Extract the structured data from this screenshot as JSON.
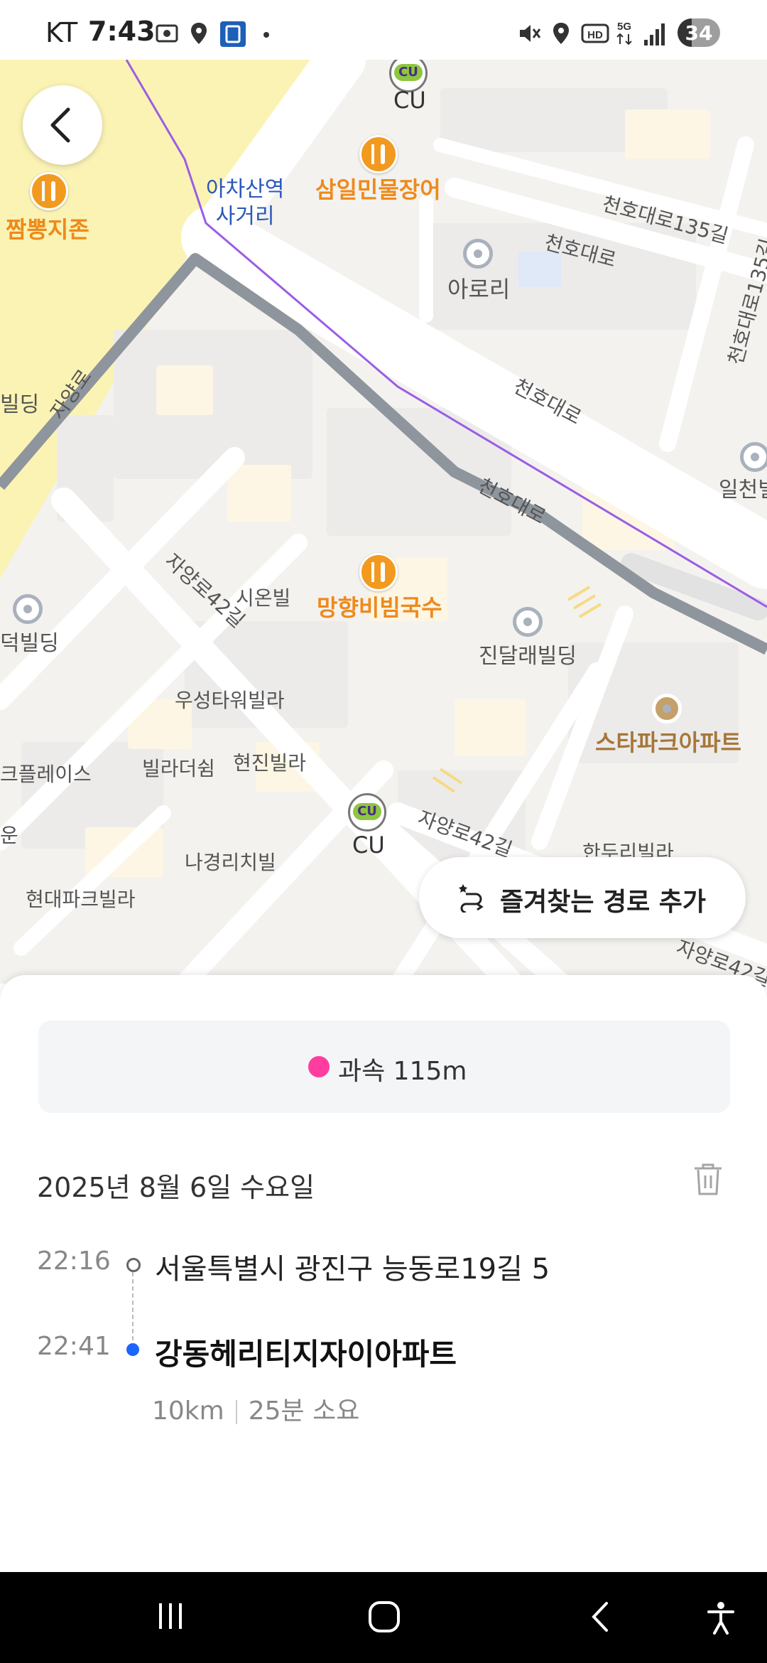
{
  "status_bar": {
    "carrier": "KT",
    "time": "7:43",
    "battery": "34",
    "battery_level": 0.34
  },
  "map": {
    "labels": {
      "intersection": "아차산역\n사거리",
      "poi_jjambbong": "짬뽕지존",
      "poi_samil": "삼일민물장어",
      "poi_manghyang": "망향비빔국수",
      "cu_top": "CU",
      "cu_bottom": "CU",
      "arori": "아로리",
      "cheonho135": "천호대로135길",
      "cheonho_small": "천호대로",
      "cheonho_mid": "천호대로",
      "cheonho_road": "천호대로",
      "cheonho135_vert": "천호대로135길",
      "ilcheon": "일천빌",
      "bilding_left": "빌딩",
      "jayang_ro": "자양로",
      "jayang42_top": "자양로42길",
      "jayang42_mid": "자양로42길",
      "jayang42_bottom": "자양로42길",
      "sion": "시온빌",
      "deok": "덕빌딩",
      "jindal": "진달래빌딩",
      "wooseong": "우성타워빌라",
      "starpark": "스타파크아파트",
      "place": "크플레이스",
      "villa_the_swim": "빌라더쉼",
      "hyunjin": "현진빌라",
      "un": "운",
      "nagyeong": "나경리치빌",
      "handuri": "한두리빌라",
      "hyundaipark": "현대파크빌라"
    }
  },
  "fav_route_button": {
    "label": "즐겨찾는 경로 추가"
  },
  "sheet": {
    "speeding": "과속 115m",
    "date": "2025년 8월 6일 수요일",
    "origin": {
      "time": "22:16",
      "address": "서울특별시 광진구 능동로19길 5"
    },
    "destination": {
      "time": "22:41",
      "name": "강동헤리티지자이아파트"
    },
    "distance": "10km",
    "duration": "25분 소요"
  },
  "colors": {
    "route_gray": "#8e959c",
    "route_purple": "#9b5de5",
    "poi_orange": "#ee8a1b",
    "speed_dot": "#ff3ca0",
    "dest_dot": "#1a66ff"
  }
}
